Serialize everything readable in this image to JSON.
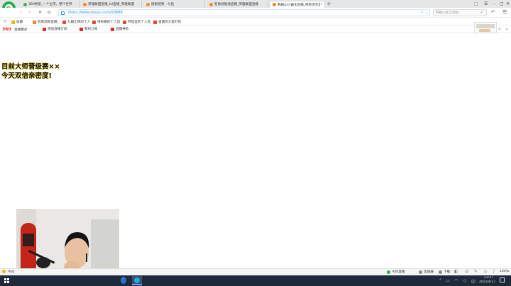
{
  "tabs": [
    {
      "label": "360导航_一个主页，整个世界",
      "active": false,
      "color": "#3cb54a"
    },
    {
      "label": "英雄联盟直播_lol直播_英雄联盟",
      "active": false,
      "color": "#f08a24"
    },
    {
      "label": "搜索结果 - 斗鱼",
      "active": false,
      "color": "#f08a24"
    },
    {
      "label": "智勋勋勋勋直播_英雄联盟直播",
      "active": false,
      "color": "#f08a24"
    },
    {
      "label": "韩跳山小霸王直播_绝地求生直",
      "active": true,
      "color": "#f08a24"
    }
  ],
  "new_tab": "+",
  "window_controls": {
    "skin": "⬚",
    "menu": "☰",
    "minimize": "–",
    "maximize": "□",
    "close": "✕"
  },
  "nav": {
    "back": "‹",
    "forward": "›",
    "stop": "✕",
    "home": "⌂",
    "url": "https://www.douyu.com/93888",
    "url_domain": "douyu",
    "search_placeholder": "韩跳山还又迎起",
    "search_icon": "search-icon"
  },
  "bookmarks": [
    {
      "label": "收藏",
      "color": "#f5b400"
    },
    {
      "label": "智勋勋勋直播_",
      "color": "#f08a24"
    },
    {
      "label": "九趣止牌的个人",
      "color": "#e14b2b"
    },
    {
      "label": "林宥嘉的个人直",
      "color": "#e14b2b"
    },
    {
      "label": "阿怪蛮的个人直",
      "color": "#e14b2b"
    },
    {
      "label": "里面的大蛋打的",
      "color": "#e14b2b"
    }
  ],
  "mode_bar": {
    "brand": "360",
    "mode": "直播模式",
    "links": [
      "添加直播订阅",
      "我的订阅",
      "直播导航"
    ]
  },
  "overlay": {
    "line1": "目前大师晋级赛××",
    "line2": "今天双倍亲密度!"
  },
  "status_bar": {
    "left": "今日",
    "right_items": [
      "今日直播",
      "加速器",
      "下载"
    ],
    "zoom": "100%"
  },
  "taskbar": {
    "time": "23:27",
    "date": "2021/4/17"
  }
}
